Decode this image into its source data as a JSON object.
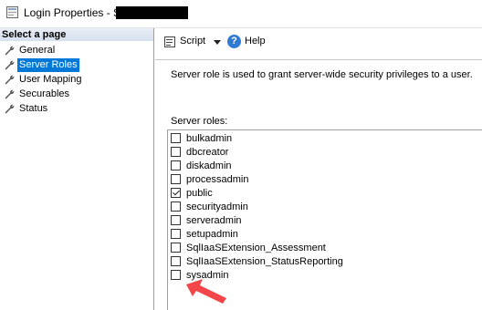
{
  "window": {
    "title": "Login Properties - S"
  },
  "sidebar": {
    "header": "Select a page",
    "items": [
      {
        "label": "General",
        "selected": false
      },
      {
        "label": "Server Roles",
        "selected": true
      },
      {
        "label": "User Mapping",
        "selected": false
      },
      {
        "label": "Securables",
        "selected": false
      },
      {
        "label": "Status",
        "selected": false
      }
    ]
  },
  "toolbar": {
    "script_label": "Script",
    "help_label": "Help"
  },
  "content": {
    "description": "Server role is used to grant server-wide security privileges to a user.",
    "roles_label": "Server roles:",
    "roles": [
      {
        "name": "bulkadmin",
        "checked": false
      },
      {
        "name": "dbcreator",
        "checked": false
      },
      {
        "name": "diskadmin",
        "checked": false
      },
      {
        "name": "processadmin",
        "checked": false
      },
      {
        "name": "public",
        "checked": true
      },
      {
        "name": "securityadmin",
        "checked": false
      },
      {
        "name": "serveradmin",
        "checked": false
      },
      {
        "name": "setupadmin",
        "checked": false
      },
      {
        "name": "SqlIaaSExtension_Assessment",
        "checked": false
      },
      {
        "name": "SqlIaaSExtension_StatusReporting",
        "checked": false
      },
      {
        "name": "sysadmin",
        "checked": false
      }
    ]
  },
  "colors": {
    "selection": "#0078d7",
    "annotation_arrow": "#f2464b"
  }
}
